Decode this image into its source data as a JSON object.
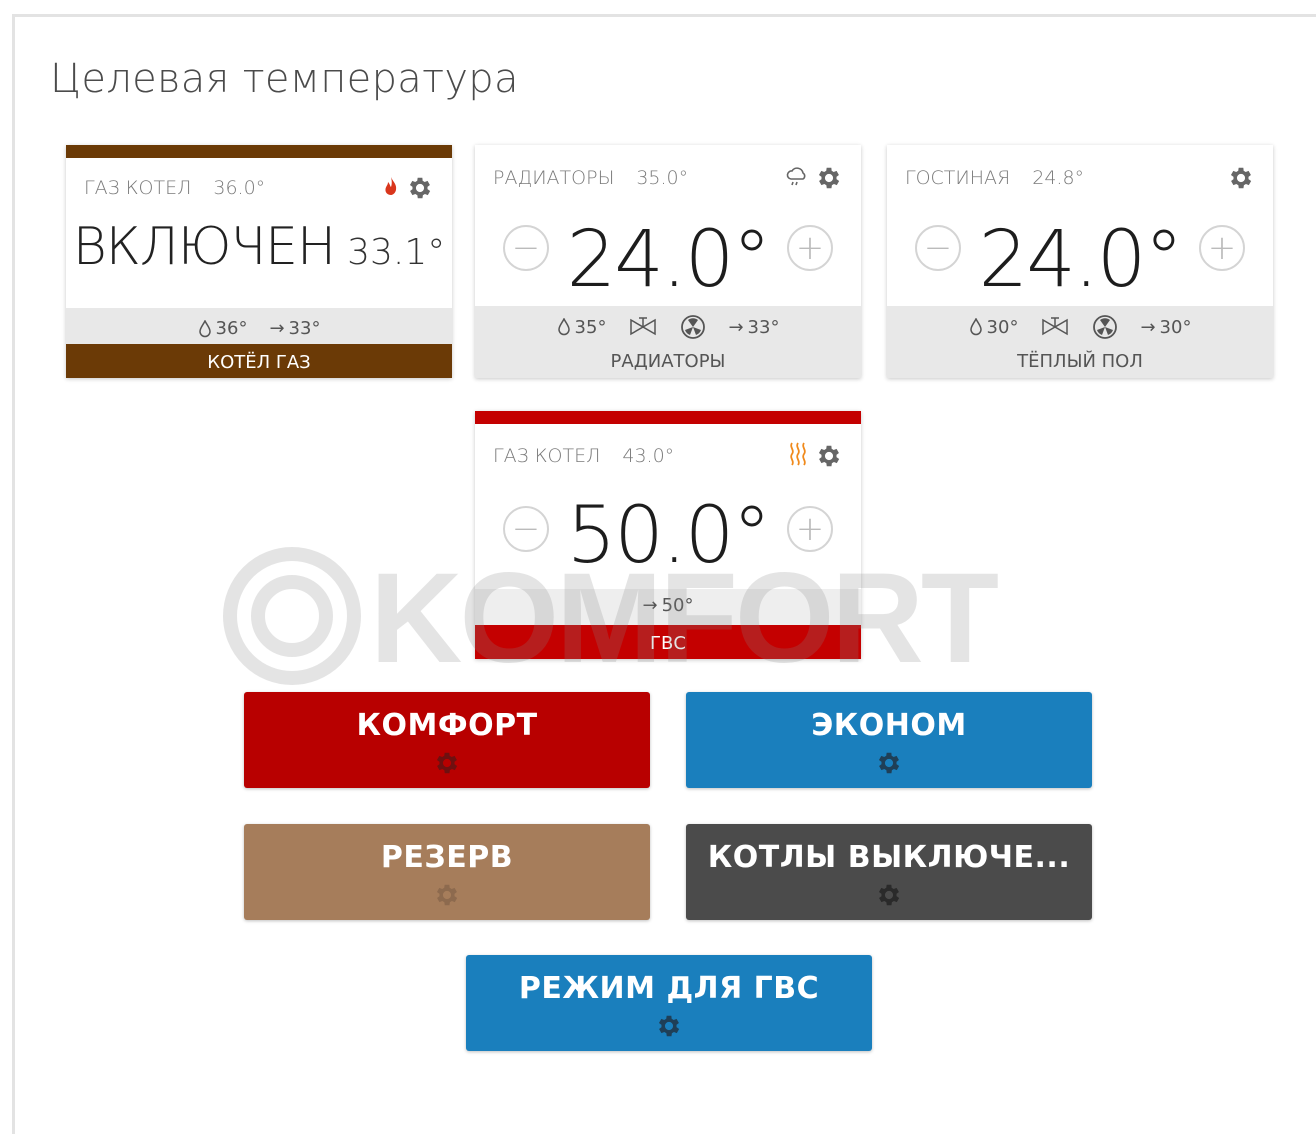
{
  "page": {
    "title": "Целевая температура"
  },
  "colors": {
    "boiler_brown": "#6b3a06",
    "dhw_red": "#c40000",
    "comfort_red": "#b80000",
    "econ_blue": "#1a7fbd",
    "reserve_tan": "#a67d5b",
    "off_gray": "#4b4b4b",
    "flame_red": "#d9361c",
    "heat_orange": "#f08a1c"
  },
  "cards": [
    {
      "name": "ГАЗ КОТЕЛ",
      "temp": "36.0°",
      "state": "ВКЛЮЧЕН",
      "current": "33.1°",
      "supply": "36°",
      "return": "33°",
      "label": "КОТЁЛ ГАЗ",
      "status_icon": "flame-icon"
    },
    {
      "name": "РАДИАТОРЫ",
      "temp": "35.0°",
      "setpoint": "24.0°",
      "supply": "35°",
      "return": "33°",
      "label": "РАДИАТОРЫ",
      "status_icon": "weather-icon"
    },
    {
      "name": "ГОСТИНАЯ",
      "temp": "24.8°",
      "setpoint": "24.0°",
      "supply": "30°",
      "return": "30°",
      "label": "ТЁПЛЫЙ ПОЛ"
    },
    {
      "name": "ГАЗ КОТЕЛ",
      "temp": "43.0°",
      "setpoint": "50.0°",
      "return": "50°",
      "label": "ГВС",
      "status_icon": "heating-icon"
    }
  ],
  "watermark": "KOMFORT",
  "modes": [
    {
      "label": "КОМФОРТ"
    },
    {
      "label": "ЭКОНОМ"
    },
    {
      "label": "РЕЗЕРВ"
    },
    {
      "label": "КОТЛЫ ВЫКЛЮЧЕ..."
    },
    {
      "label": "РЕЖИМ ДЛЯ ГВС"
    }
  ]
}
